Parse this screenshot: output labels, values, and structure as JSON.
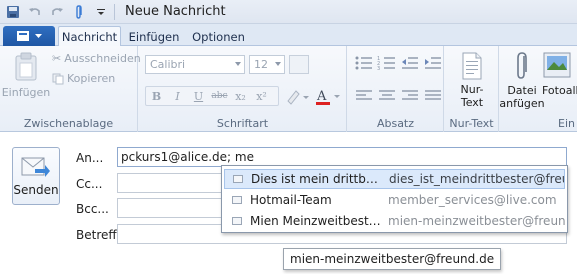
{
  "window": {
    "title": "Neue Nachricht"
  },
  "tabs": [
    {
      "label": "Nachricht",
      "active": true
    },
    {
      "label": "Einfügen",
      "active": false
    },
    {
      "label": "Optionen",
      "active": false
    }
  ],
  "ribbon": {
    "clipboard": {
      "paste_label": "Einfügen",
      "cut_label": "Ausschneiden",
      "copy_label": "Kopieren",
      "group_label": "Zwischenablage"
    },
    "font": {
      "font_name": "Calibri",
      "font_size": "12",
      "group_label": "Schriftart",
      "buttons": [
        "B",
        "I",
        "U",
        "abc",
        "x₂",
        "x²"
      ]
    },
    "paragraph": {
      "group_label": "Absatz"
    },
    "plaintext": {
      "button_label_1": "Nur-",
      "button_label_2": "Text",
      "group_label": "Nur-Text"
    },
    "insert": {
      "attach_label_1": "Datei",
      "attach_label_2": "anfügen",
      "photo_label": "Fotoalb",
      "group_label": "Ein"
    }
  },
  "form": {
    "send_label": "Senden",
    "to_label": "An...",
    "to_value": "pckurs1@alice.de; me",
    "cc_label": "Cc...",
    "bcc_label": "Bcc...",
    "subject_label": "Betreff"
  },
  "autocomplete": [
    {
      "name": "Dies ist mein drittbester...",
      "email": "dies_ist_meindrittbester@freun...",
      "selected": true
    },
    {
      "name": "Hotmail-Team",
      "email": "member_services@live.com",
      "selected": false
    },
    {
      "name": "Mien Meinzweitbester F...",
      "email": "mien-meinzweitbester@freund...",
      "selected": false
    }
  ],
  "tooltip": {
    "text": "mien-meinzweitbester@freund.de"
  },
  "colors": {
    "accent": "#1f57a4",
    "ribbon_bg": "#e8eef7",
    "selection": "#dbe9fb"
  }
}
